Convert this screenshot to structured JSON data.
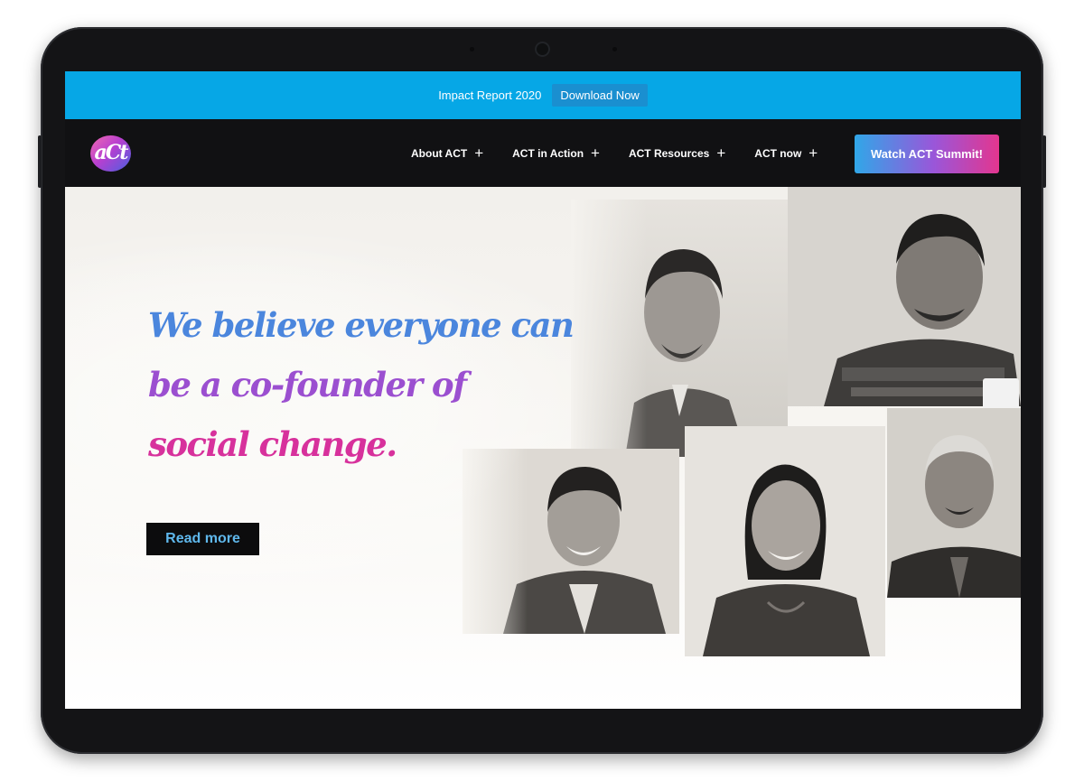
{
  "banner": {
    "text": "Impact Report 2020",
    "button": "Download Now"
  },
  "nav": {
    "logo_text": "aCt",
    "items": [
      {
        "label": "About ACT",
        "icon": "plus-icon"
      },
      {
        "label": "ACT in Action",
        "icon": "plus-icon"
      },
      {
        "label": "ACT Resources",
        "icon": "plus-icon"
      },
      {
        "label": "ACT now",
        "icon": "plus-icon"
      }
    ],
    "cta": "Watch ACT Summit!"
  },
  "hero": {
    "headline": [
      "We believe everyone can",
      "be a co-founder of",
      "social change."
    ],
    "read_more": "Read more"
  },
  "colors": {
    "banner": "#06a7e6",
    "nav": "#111113",
    "headline_blue": "#4b86dd",
    "headline_purple": "#9b4fd0",
    "headline_pink": "#d7319c",
    "cta_gradient": [
      "#30a7e8",
      "#9a56d9",
      "#e3368f"
    ]
  }
}
